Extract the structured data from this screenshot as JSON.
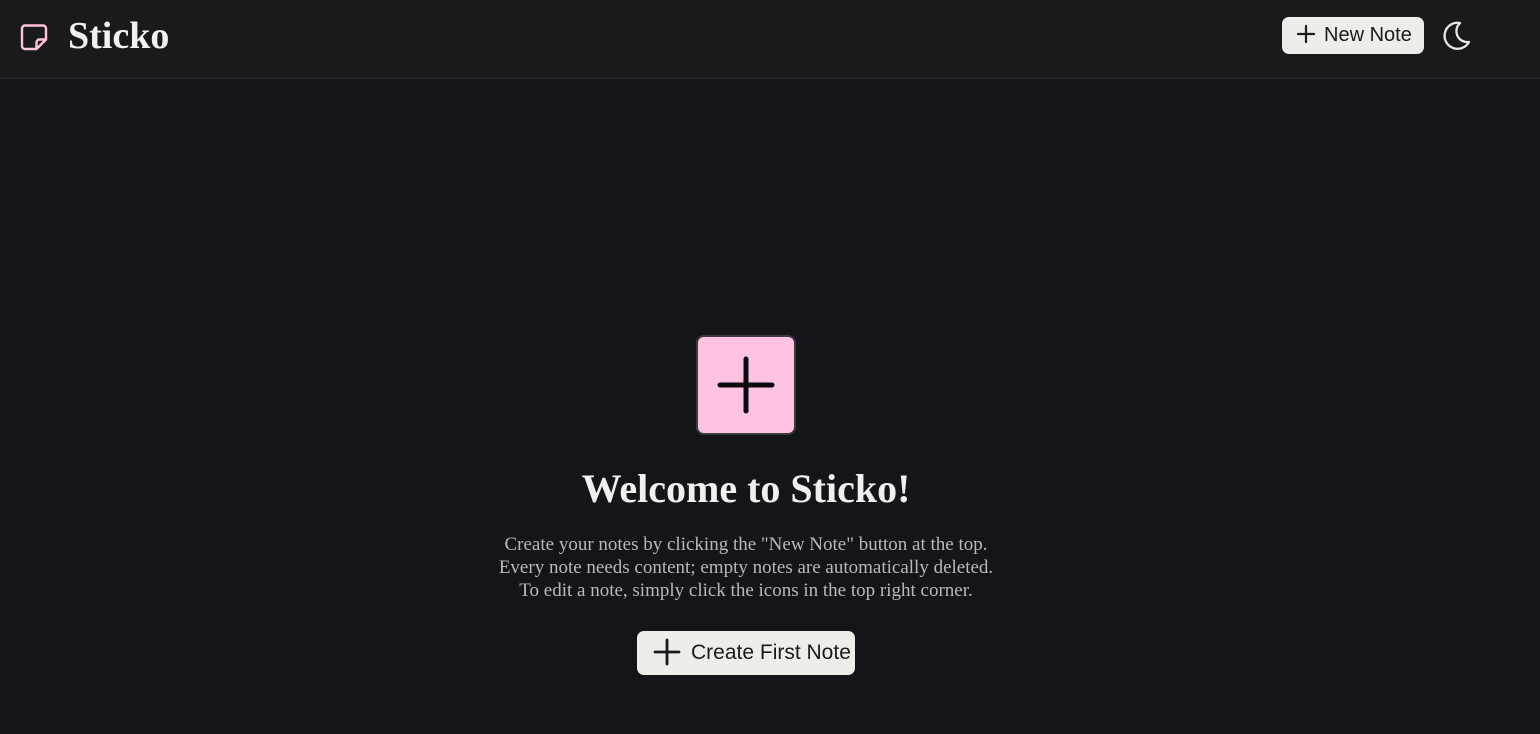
{
  "header": {
    "brand_icon": "sticky-note-icon",
    "title": "Sticko",
    "new_note_label": "New Note",
    "new_note_icon": "plus-icon",
    "theme_icon": "moon-icon"
  },
  "main": {
    "hero_icon": "plus-icon",
    "welcome_title": "Welcome to Sticko!",
    "description": [
      "Create your notes by clicking the \"New Note\" button at the top.",
      "Every note needs content; empty notes are automatically deleted.",
      "To edit a note, simply click the icons in the top right corner."
    ],
    "create_first_label": "Create First Note",
    "create_first_icon": "plus-icon"
  },
  "colors": {
    "background": "#141518",
    "header_background": "#1a1a1c",
    "accent_pink": "#ffc3e2",
    "button_background": "#efedea"
  }
}
